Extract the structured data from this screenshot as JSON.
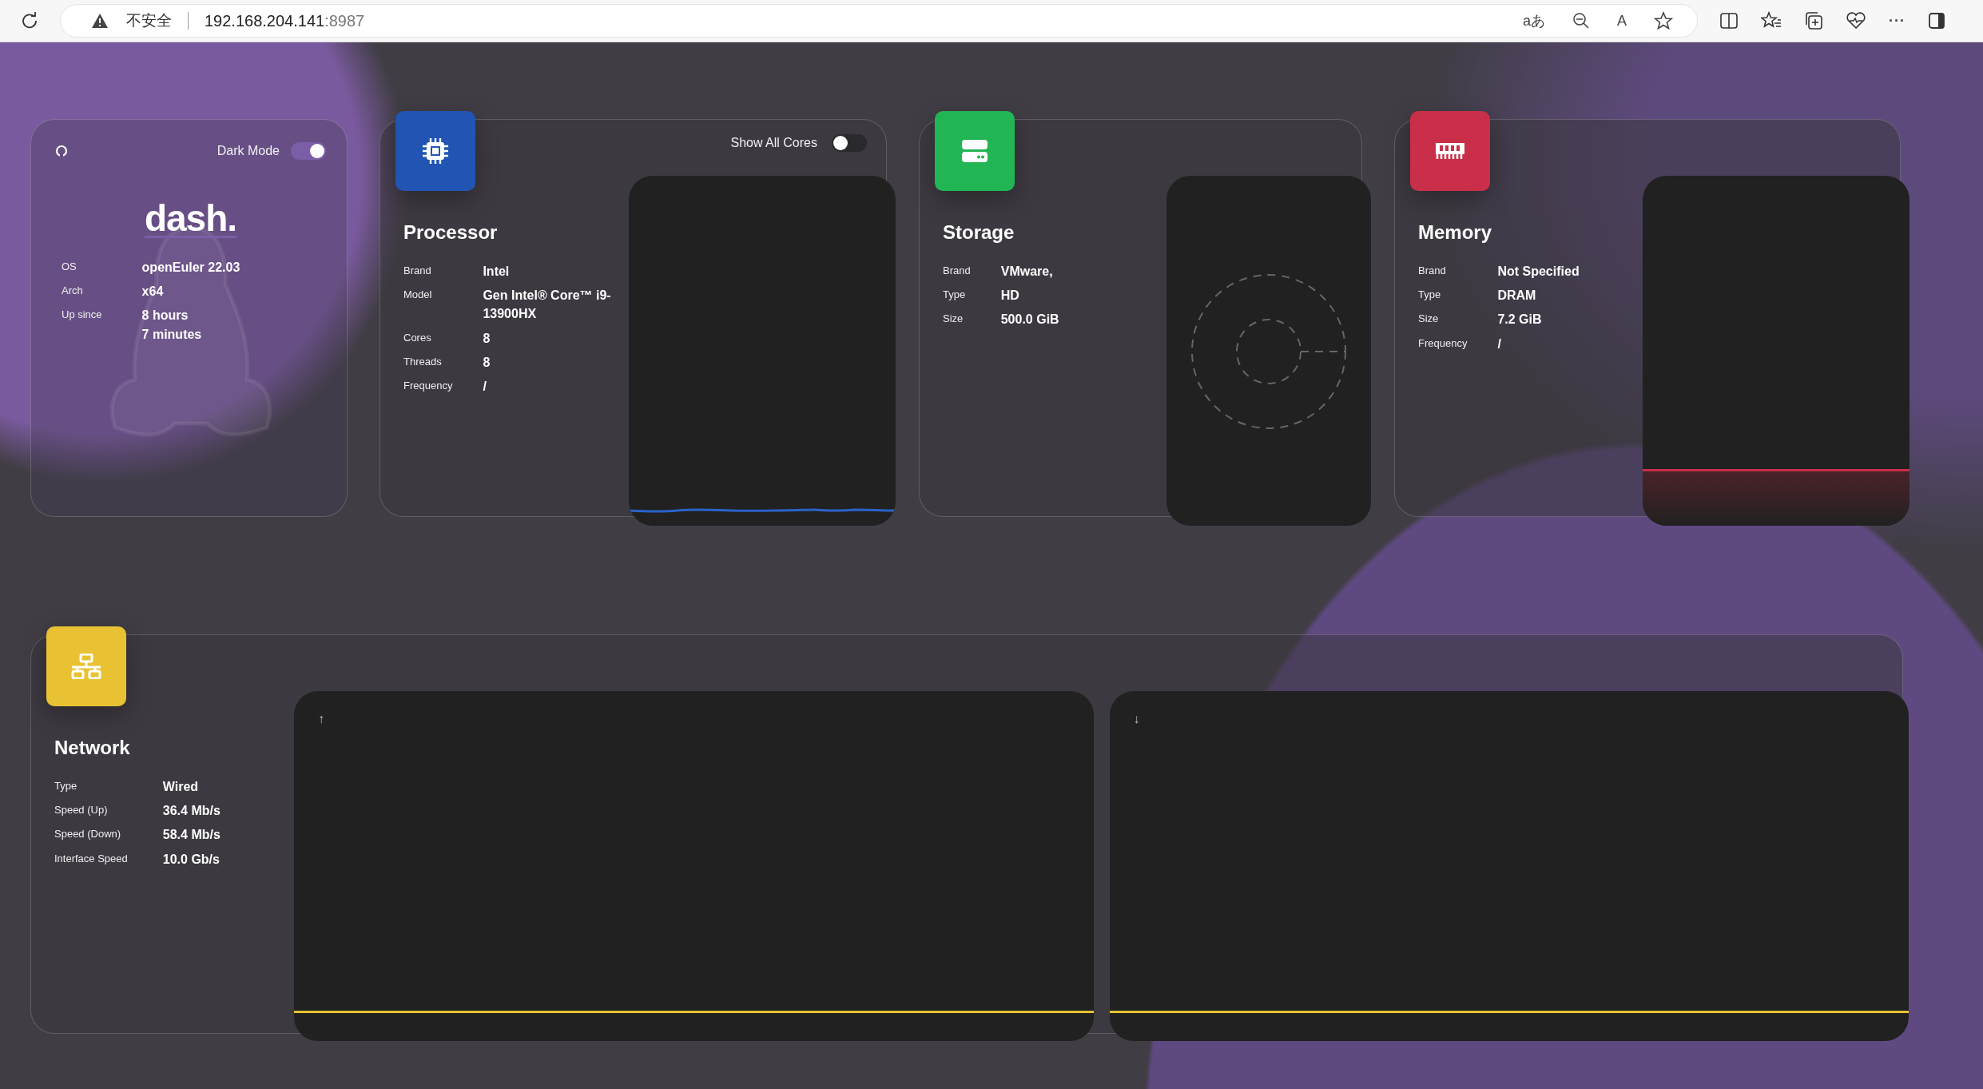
{
  "browser": {
    "security_label": "不安全",
    "url_host": "192.168.204.141",
    "url_port": ":8987",
    "translate_glyph": "aあ",
    "read_aloud_glyph": "A",
    "more_glyph": "···"
  },
  "dash_card": {
    "dark_mode_label": "Dark Mode",
    "dark_mode_on": true,
    "logo": "dash.",
    "rows": [
      {
        "label": "OS",
        "value": "openEuler 22.03"
      },
      {
        "label": "Arch",
        "value": "x64"
      },
      {
        "label": "Up since",
        "value": "8 hours\n7 minutes"
      }
    ]
  },
  "widgets": [
    {
      "kind": "cpu",
      "title": "Processor",
      "color": "#2255b3",
      "toggle_label": "Show All Cores",
      "toggle_on": false,
      "rows": [
        {
          "label": "Brand",
          "value": "Intel"
        },
        {
          "label": "Model",
          "value": "Gen Intel® Core™ i9-\n13900HX"
        },
        {
          "label": "Cores",
          "value": "8"
        },
        {
          "label": "Threads",
          "value": "8"
        },
        {
          "label": "Frequency",
          "value": "/"
        }
      ]
    },
    {
      "kind": "storage",
      "title": "Storage",
      "color": "#22b553",
      "rows": [
        {
          "label": "Brand",
          "value": "VMware,"
        },
        {
          "label": "Type",
          "value": "HD"
        },
        {
          "label": "Size",
          "value": "500.0 GiB"
        }
      ]
    },
    {
      "kind": "memory",
      "title": "Memory",
      "color": "#c92f48",
      "rows": [
        {
          "label": "Brand",
          "value": "Not Specified"
        },
        {
          "label": "Type",
          "value": "DRAM"
        },
        {
          "label": "Size",
          "value": "7.2 GiB"
        },
        {
          "label": "Frequency",
          "value": "/"
        }
      ]
    }
  ],
  "network": {
    "title": "Network",
    "color": "#e8c233",
    "rows": [
      {
        "label": "Type",
        "value": "Wired"
      },
      {
        "label": "Speed (Up)",
        "value": "36.4 Mb/s"
      },
      {
        "label": "Speed (Down)",
        "value": "58.4 Mb/s"
      },
      {
        "label": "Interface Speed",
        "value": "10.0 Gb/s"
      }
    ],
    "graphs": [
      {
        "arrow": "↑"
      },
      {
        "arrow": "↓"
      }
    ]
  }
}
